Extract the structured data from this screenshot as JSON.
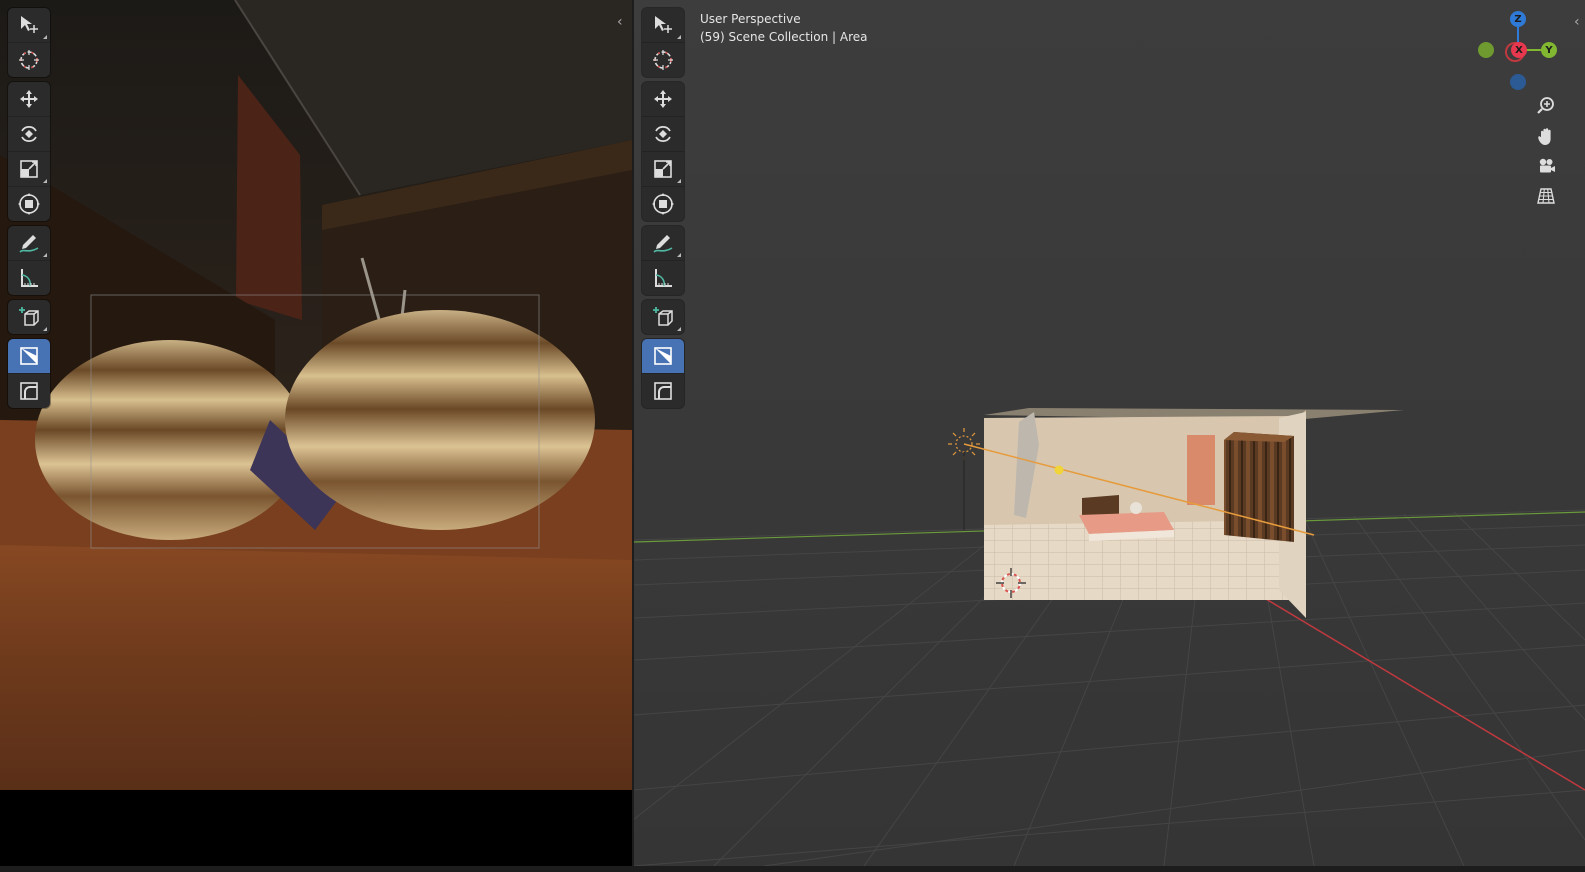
{
  "left_viewport": {
    "collapse_glyph": "‹"
  },
  "right_viewport": {
    "view_name": "User Perspective",
    "collection_line": "(59) Scene Collection | Area",
    "collapse_glyph": "‹",
    "gizmo": {
      "z_label": "Z",
      "x_label": "X",
      "y_label": "Y",
      "colors": {
        "x": "#e8384f",
        "y": "#82b732",
        "z": "#2e7ad6"
      }
    }
  },
  "toolbar_tools": [
    "select-box-tool",
    "cursor-tool",
    "move-tool",
    "rotate-tool",
    "scale-tool",
    "transform-tool",
    "annotate-tool",
    "measure-tool",
    "add-cube-tool",
    "shear-tool",
    "bend-tool"
  ],
  "nav_buttons": [
    "zoom-icon",
    "hand-pan-icon",
    "camera-icon",
    "grid-icon"
  ],
  "colors": {
    "active_tool": "#4772b3",
    "toolbar_bg": "#2b2b2b",
    "viewport_bg": "#3a3a3a",
    "axis_x": "#c0393f",
    "axis_y": "#6a9a3a"
  }
}
